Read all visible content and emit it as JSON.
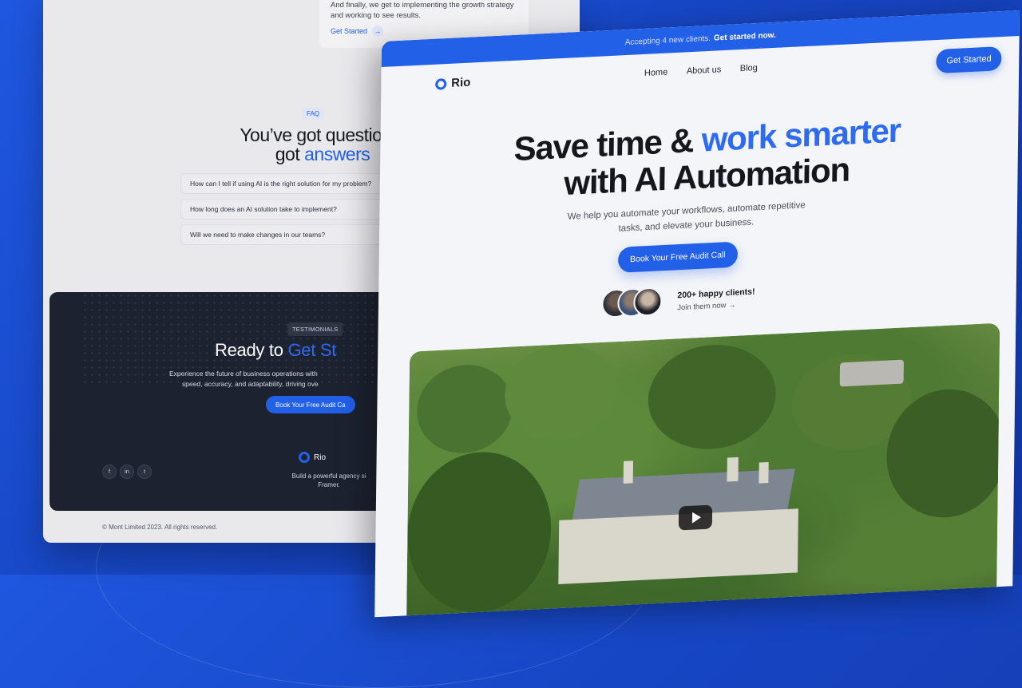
{
  "back_page": {
    "step_text": "And finally, we get to implementing the growth strategy and working to see results.",
    "step_link": "Get Started",
    "faq_badge": "FAQ",
    "faq_title_line1": "You’ve got questions,",
    "faq_title_line2_prefix": "got ",
    "faq_title_line2_accent": "answers",
    "faq_items": [
      "How can I tell if using AI is the right solution for my problem?",
      "How long does an AI solution take to implement?",
      "Will we need to make changes in our teams?"
    ],
    "testimonials_badge": "TESTIMONIALS",
    "ready_prefix": "Ready to ",
    "ready_accent": "Get St",
    "experience_line1": "Experience the future of business operations with",
    "experience_line2": "speed, accuracy, and adaptability, driving ove",
    "audit_button": "Book Your Free Audit Ca",
    "footer_brand": "Rio",
    "footer_desc_line1": "Build a powerful agency si",
    "footer_desc_line2": "Framer.",
    "copyright": "© Mont Limited 2023. All rights reserved."
  },
  "front_page": {
    "announcement_prefix": "Accepting 4 new clients.",
    "announcement_strong": "Get started now.",
    "brand": "Rio",
    "nav": [
      "Home",
      "About us",
      "Blog"
    ],
    "header_cta": "Get Started",
    "hero_line1_prefix": "Save time & ",
    "hero_line1_accent": "work smarter",
    "hero_line2": "with AI Automation",
    "hero_sub": "We help you automate your workflows, automate repetitive tasks, and elevate your business.",
    "cta": "Book Your Free Audit Call",
    "happy_clients": "200+ happy clients!",
    "join_now": "Join them now →"
  },
  "colors": {
    "brand_blue": "#2360e8",
    "background_blue": "#1f57e0",
    "dark_footer": "#1c2230"
  },
  "icons": {
    "arrow": "→",
    "facebook": "f",
    "linkedin": "in",
    "twitter": "t",
    "play": "play-icon"
  }
}
